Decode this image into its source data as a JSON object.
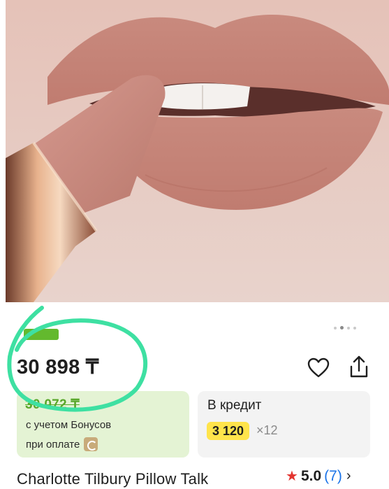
{
  "product": {
    "name": "Charlotte Tilbury Pillow Talk",
    "image_alt": "lipstick product photo"
  },
  "gallery": {
    "total": 4,
    "active_index": 1
  },
  "price": {
    "current": "30 898 ₸",
    "old": "30 072 ₸"
  },
  "bonus": {
    "line1": "с учетом Бонусов",
    "line2": "при оплате"
  },
  "credit": {
    "title": "В кредит",
    "amount": "3 120",
    "term": "×12"
  },
  "rating": {
    "value": "5.0",
    "count": "(7)"
  },
  "colors": {
    "accent_green": "#63b92e",
    "credit_yellow": "#ffe44b",
    "link_blue": "#1a73e8",
    "star_red": "#e3342f",
    "annotation_mint": "#3ee0a2"
  },
  "icons": [
    "heart-icon",
    "share-icon",
    "star-icon",
    "chevron-right-icon",
    "kaspi-bonus-icon"
  ]
}
